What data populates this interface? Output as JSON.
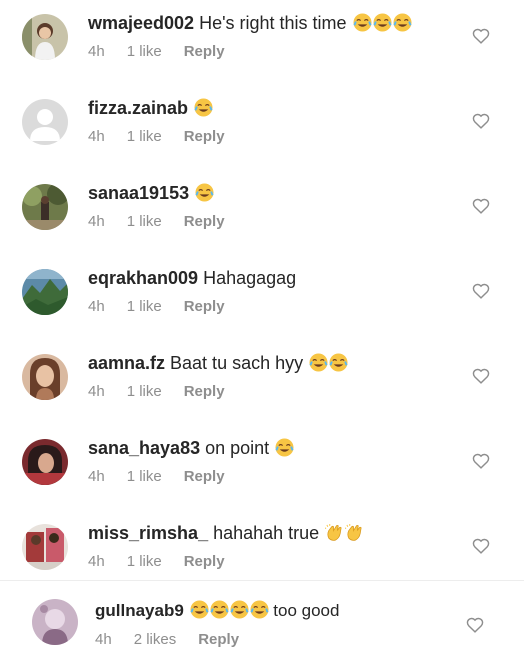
{
  "comments": [
    {
      "username": "wmajeed002",
      "text": " He's right this time",
      "emoji": "😂😂😂",
      "time": "4h",
      "likes": "1 like",
      "reply": "Reply"
    },
    {
      "username": "fizza.zainab",
      "text": " ",
      "emoji": "😂",
      "time": "4h",
      "likes": "1 like",
      "reply": "Reply"
    },
    {
      "username": "sanaa19153",
      "text": " ",
      "emoji": "😂",
      "time": "4h",
      "likes": "1 like",
      "reply": "Reply"
    },
    {
      "username": "eqrakhan009",
      "text": " Hahagagag",
      "emoji": "",
      "time": "4h",
      "likes": "1 like",
      "reply": "Reply"
    },
    {
      "username": "aamna.fz",
      "text": " Baat tu sach hyy",
      "emoji": "😂😂",
      "time": "4h",
      "likes": "1 like",
      "reply": "Reply"
    },
    {
      "username": "sana_haya83",
      "text": " on point",
      "emoji": "😂",
      "time": "4h",
      "likes": "1 like",
      "reply": "Reply"
    },
    {
      "username": "miss_rimsha_",
      "text": " hahahah true ",
      "emoji": "👏👏",
      "time": "4h",
      "likes": "1 like",
      "reply": "Reply"
    },
    {
      "username": "gullnayab9",
      "text": " ",
      "emoji": "😂😂😂😂",
      "text_after": "too good",
      "time": "4h",
      "likes": "2 likes",
      "reply": "Reply"
    }
  ],
  "icons": {
    "like": "heart-outline-icon"
  },
  "colors": {
    "text": "#262626",
    "meta": "#8e8e8e",
    "heart_stroke": "#8e8e8e",
    "emoji_face": "#f7c544"
  }
}
